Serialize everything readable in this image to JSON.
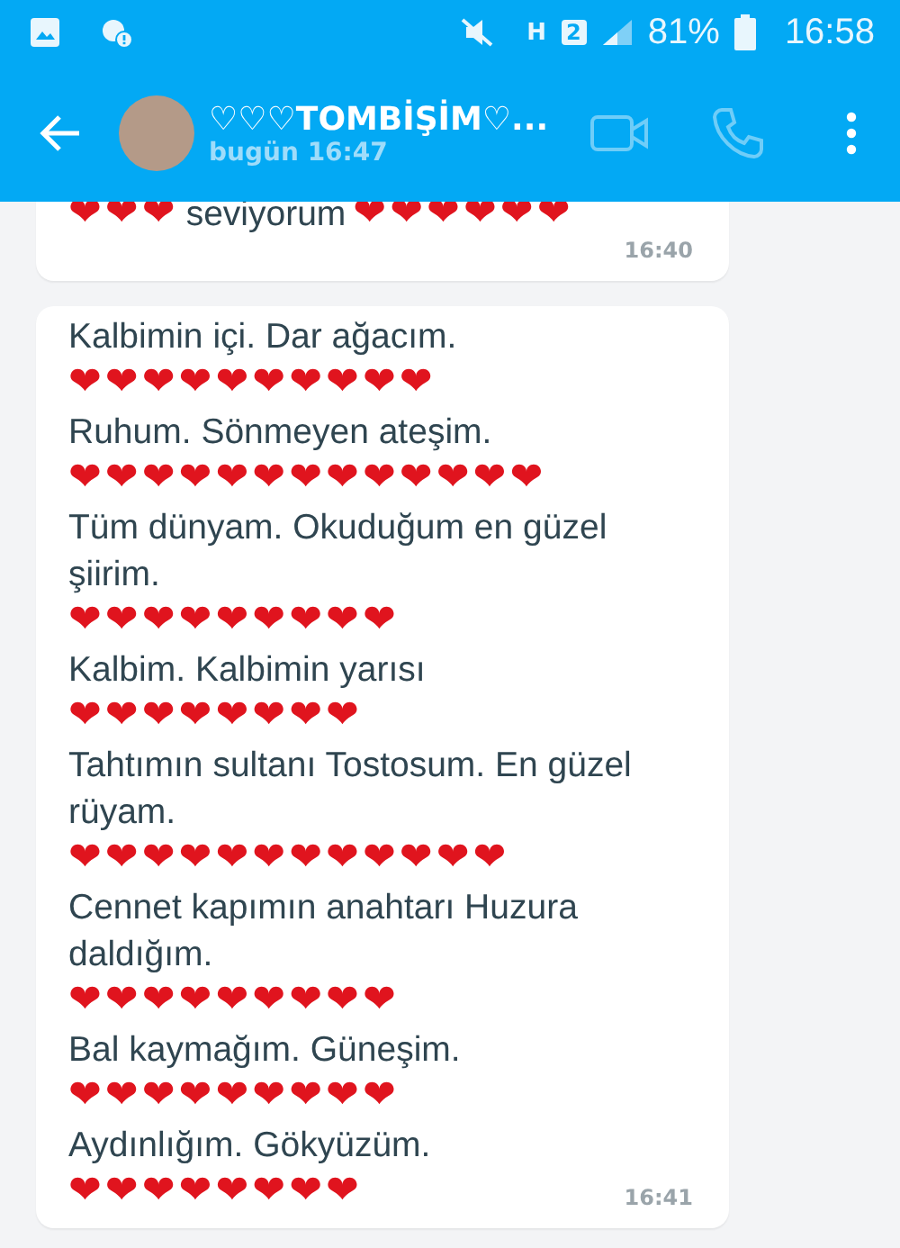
{
  "status_bar": {
    "battery": "81%",
    "time": "16:58",
    "sim": "2",
    "network": "H"
  },
  "header": {
    "title": "♡♡♡TOMBİŞİM♡...",
    "subtitle": "bugün 16:47"
  },
  "messages": [
    {
      "lines": [
        {
          "kind": "mixed",
          "hearts_before": "❤❤❤",
          "text": "seviyorum",
          "hearts_after": "❤❤❤❤❤❤"
        }
      ],
      "time": "16:40"
    },
    {
      "lines": [
        {
          "kind": "text",
          "text": "Kalbimin içi. Dar ağacım."
        },
        {
          "kind": "hearts",
          "text": "❤❤❤❤❤❤❤❤❤❤"
        },
        {
          "kind": "text",
          "text": "Ruhum. Sönmeyen ateşim."
        },
        {
          "kind": "hearts",
          "text": "❤❤❤❤❤❤❤❤❤❤❤❤❤"
        },
        {
          "kind": "text",
          "text": "Tüm dünyam. Okuduğum en güzel şiirim."
        },
        {
          "kind": "hearts",
          "text": "❤❤❤❤❤❤❤❤❤"
        },
        {
          "kind": "text",
          "text": "Kalbim. Kalbimin yarısı"
        },
        {
          "kind": "hearts",
          "text": "❤❤❤❤❤❤❤❤"
        },
        {
          "kind": "text",
          "text": "Tahtımın sultanı Tostosum. En güzel rüyam."
        },
        {
          "kind": "hearts",
          "text": "❤❤❤❤❤❤❤❤❤❤❤❤"
        },
        {
          "kind": "text",
          "text": "Cennet kapımın anahtarı Huzura daldığım."
        },
        {
          "kind": "hearts",
          "text": "❤❤❤❤❤❤❤❤❤"
        },
        {
          "kind": "text",
          "text": "Bal kaymağım. Güneşim."
        },
        {
          "kind": "hearts",
          "text": "❤❤❤❤❤❤❤❤❤"
        },
        {
          "kind": "text",
          "text": "Aydınlığım. Gökyüzüm."
        },
        {
          "kind": "hearts",
          "text": "❤❤❤❤❤❤❤❤"
        }
      ],
      "time": "16:41"
    }
  ]
}
